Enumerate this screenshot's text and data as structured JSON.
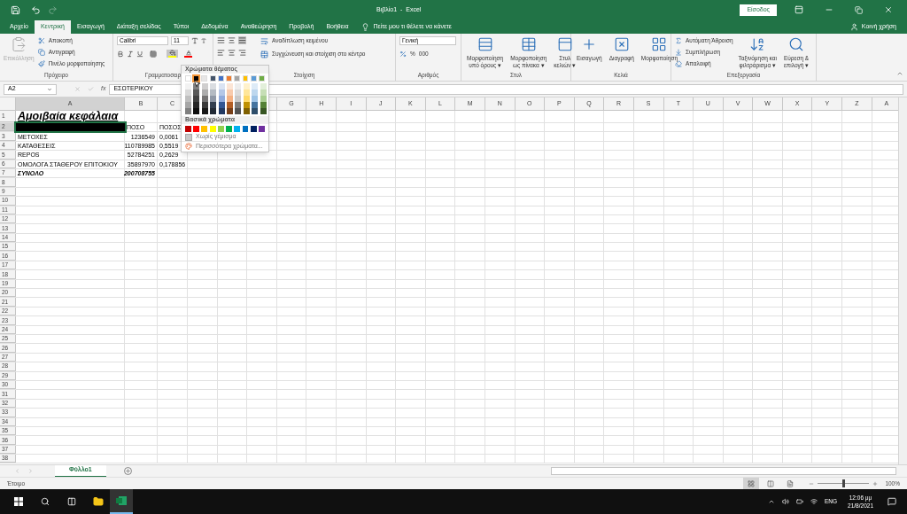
{
  "title_bar": {
    "title": "Βιβλίο1  -  Excel",
    "sign_in": "Είσοδος"
  },
  "tabs": [
    {
      "label": "Αρχείο",
      "selected": false
    },
    {
      "label": "Κεντρική",
      "selected": true
    },
    {
      "label": "Εισαγωγή",
      "selected": false
    },
    {
      "label": "Διάταξη σελίδας",
      "selected": false
    },
    {
      "label": "Τύποι",
      "selected": false
    },
    {
      "label": "Δεδομένα",
      "selected": false
    },
    {
      "label": "Αναθεώρηση",
      "selected": false
    },
    {
      "label": "Προβολή",
      "selected": false
    },
    {
      "label": "Βοήθεια",
      "selected": false
    }
  ],
  "tell_me": "Πείτε μου τι θέλετε να κάνετε",
  "share": "Κοινή χρήση",
  "ribbon": {
    "clipboard": {
      "paste": {
        "label": "Επικόλληση",
        "disabled": true
      },
      "items": [
        {
          "kind": "cut",
          "label": "Αποκοπή"
        },
        {
          "kind": "copy",
          "label": "Αντιγραφή"
        },
        {
          "kind": "painter",
          "label": "Πινέλο μορφοποίησης"
        }
      ],
      "label": "Πρόχειρο"
    },
    "font": {
      "name": "Calibri",
      "size": "11",
      "fill_button": {
        "color": "#ffff00"
      },
      "font_color_button": {
        "color": "#ff0000"
      },
      "label": "Γραμματοσειρ"
    },
    "alignment": {
      "wrap": "Αναδίπλωση κειμένου",
      "merge": "Συγχώνευση και στοίχιση στο κέντρο",
      "label": "Στοίχιση"
    },
    "number": {
      "format": "Γενική",
      "percent": "%",
      "thousands": "000",
      "label": "Αριθμός"
    },
    "styles": {
      "buttons": [
        {
          "kind": "conditional",
          "lines": [
            "Μορφοποίηση",
            "υπό όρους ▾"
          ]
        },
        {
          "kind": "table",
          "lines": [
            "Μορφοποίηση",
            "ως πίνακα ▾"
          ]
        },
        {
          "kind": "cellstyle",
          "lines": [
            "Στυλ",
            "κελιών ▾"
          ]
        }
      ],
      "label": "Στυλ"
    },
    "cells": {
      "buttons": [
        {
          "kind": "insert",
          "label": "Εισαγωγή"
        },
        {
          "kind": "delete",
          "label": "Διαγραφή"
        },
        {
          "kind": "format",
          "label": "Μορφοποίηση"
        }
      ],
      "label": "Κελιά"
    },
    "editing": {
      "items": [
        {
          "kind": "sum",
          "label": "Αυτόματη Άθροιση"
        },
        {
          "kind": "fill",
          "label": "Συμπλήρωση"
        },
        {
          "kind": "clear",
          "label": "Απαλοιφή"
        }
      ],
      "buttons": [
        {
          "kind": "sort",
          "lines": [
            "Ταξινόμηση και",
            "φιλτράρισμα ▾"
          ]
        },
        {
          "kind": "find",
          "lines": [
            "Εύρεση &",
            "επιλογή ▾"
          ]
        }
      ],
      "label": "Επεξεργασία"
    }
  },
  "formula_bar": {
    "name_box": "A2",
    "fx": "fx",
    "value": "ΕΣΩΤΕΡΙΚΟΥ"
  },
  "sheet": {
    "columns": [
      "A",
      "B",
      "C",
      null,
      null,
      null,
      "G",
      "H",
      "I",
      "J",
      "K",
      "L",
      "M",
      "N",
      "O",
      "P",
      "Q",
      "R",
      "S",
      "T",
      "U",
      "V",
      "W",
      "X",
      "Y",
      "Z",
      "A"
    ],
    "rows": [
      {
        "number": "1",
        "cells": [
          {
            "text": "Αμοιβαία κεφάλαια",
            "kind": "title"
          }
        ]
      },
      {
        "number": "2",
        "cells": [
          {
            "color": "#000000",
            "selected": true
          },
          {
            "text": "ΠΟΣΟ"
          },
          {
            "text": "ΠΟΣΟΣ"
          }
        ]
      },
      {
        "number": "3",
        "cells": [
          {
            "text": "ΜΕΤΟΧΕΣ"
          },
          {
            "text": "1236549",
            "kind": "number"
          },
          {
            "text": "0,0061"
          }
        ]
      },
      {
        "number": "4",
        "cells": [
          {
            "text": "ΚΑΤΑΘΕΣΕΙΣ"
          },
          {
            "text": "110789985",
            "kind": "number"
          },
          {
            "text": "0,5519"
          }
        ]
      },
      {
        "number": "5",
        "cells": [
          {
            "text": "REPOS"
          },
          {
            "text": "52784251",
            "kind": "number"
          },
          {
            "text": "0,2629"
          }
        ]
      },
      {
        "number": "6",
        "cells": [
          {
            "text": "ΟΜΟΛΟΓΑ ΣΤΑΘΕΡΟΥ ΕΠΙΤΟΚΙΟΥ"
          },
          {
            "text": "35897970",
            "kind": "number"
          },
          {
            "text": "0,178856"
          }
        ]
      },
      {
        "number": "7",
        "cells": [
          {
            "text": "ΣΥΝΟΛΟ",
            "kind": "total"
          },
          {
            "text": "200708755",
            "kind": "total_number"
          }
        ]
      },
      {
        "number": "8"
      },
      {
        "number": "9"
      },
      {
        "number": "10"
      },
      {
        "number": "11"
      },
      {
        "number": "12"
      },
      {
        "number": "13"
      },
      {
        "number": "14"
      },
      {
        "number": "15"
      },
      {
        "number": "16"
      },
      {
        "number": "17"
      },
      {
        "number": "18"
      },
      {
        "number": "19"
      },
      {
        "number": "20"
      },
      {
        "number": "21"
      },
      {
        "number": "22"
      },
      {
        "number": "23"
      },
      {
        "number": "24"
      },
      {
        "number": "25"
      },
      {
        "number": "26"
      },
      {
        "number": "27"
      },
      {
        "number": "28"
      },
      {
        "number": "29"
      },
      {
        "number": "30"
      },
      {
        "number": "31"
      },
      {
        "number": "32"
      },
      {
        "number": "33"
      },
      {
        "number": "34"
      },
      {
        "number": "35"
      },
      {
        "number": "36"
      },
      {
        "number": "37"
      },
      {
        "number": "38"
      }
    ]
  },
  "color_menu": {
    "theme_title": "Χρώματα θέματος",
    "theme_colors": [
      {
        "color": "#ffffff",
        "selected": false
      },
      {
        "color": "#000000",
        "selected": true
      },
      {
        "color": "#e7e6e6",
        "selected": false
      },
      {
        "color": "#44546a",
        "selected": false
      },
      {
        "color": "#4472c4",
        "selected": false
      },
      {
        "color": "#ed7d31",
        "selected": false
      },
      {
        "color": "#a5a5a5",
        "selected": false
      },
      {
        "color": "#ffc000",
        "selected": false
      },
      {
        "color": "#5b9bd5",
        "selected": false
      },
      {
        "color": "#70ad47",
        "selected": false
      }
    ],
    "standard_title": "Βασικά χρώματα",
    "standard_colors": [
      {
        "color": "#c00000",
        "selected": false
      },
      {
        "color": "#ff0000",
        "selected": false
      },
      {
        "color": "#ffc000",
        "selected": false
      },
      {
        "color": "#ffff00",
        "selected": false
      },
      {
        "color": "#92d050",
        "selected": false
      },
      {
        "color": "#00b050",
        "selected": false
      },
      {
        "color": "#00b0f0",
        "selected": false
      },
      {
        "color": "#0070c0",
        "selected": false
      },
      {
        "color": "#002060",
        "selected": false
      },
      {
        "color": "#7030a0",
        "selected": false
      }
    ],
    "no_fill": "Χωρίς γέμισμα",
    "more_colors": "Περισσότερα χρώματα..."
  },
  "sheet_tabs": [
    {
      "label": "Φύλλο1",
      "selected": true
    }
  ],
  "status_bar": {
    "status": "Έτοιμο",
    "views": [
      {
        "kind": "normal",
        "selected": true
      },
      {
        "kind": "layout",
        "selected": false
      },
      {
        "kind": "break",
        "selected": false
      }
    ],
    "zoom": {
      "level": 0.5
    },
    "zoom_label": "100%"
  },
  "taskbar": {
    "apps": [
      {
        "kind": "explorer",
        "active": false
      },
      {
        "kind": "excel",
        "active": true
      }
    ],
    "language": "ENG",
    "time": "12:06 μμ",
    "date": "21/8/2021"
  }
}
